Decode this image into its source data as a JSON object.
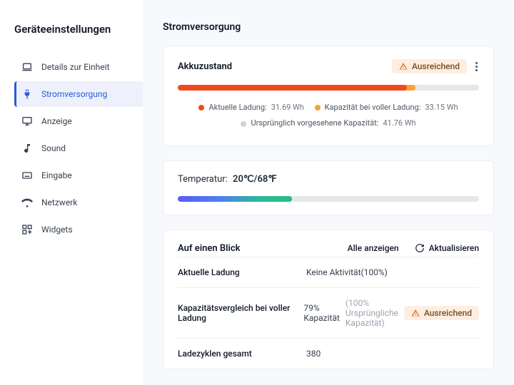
{
  "sidebar": {
    "title": "Geräteeinstellungen",
    "items": [
      {
        "label": "Details zur Einheit",
        "icon": "laptop"
      },
      {
        "label": "Stromversorgung",
        "icon": "plug"
      },
      {
        "label": "Anzeige",
        "icon": "monitor"
      },
      {
        "label": "Sound",
        "icon": "music"
      },
      {
        "label": "Eingabe",
        "icon": "keyboard"
      },
      {
        "label": "Netzwerk",
        "icon": "wifi"
      },
      {
        "label": "Widgets",
        "icon": "widgets"
      }
    ]
  },
  "main": {
    "title": "Stromversorgung",
    "battery": {
      "title": "Akkuzustand",
      "status_label": "Ausreichend",
      "legend": {
        "current_label": "Aktuelle Ladung:",
        "current_value": "31.69 Wh",
        "full_label": "Kapazität bei voller Ladung:",
        "full_value": "33.15 Wh",
        "design_label": "Ursprünglich vorgesehene Kapazität:",
        "design_value": "41.76 Wh"
      }
    },
    "temperature": {
      "label": "Temperatur:",
      "value": "20℃/68℉"
    },
    "glance": {
      "title": "Auf einen Blick",
      "show_all": "Alle anzeigen",
      "refresh": "Aktualisieren",
      "rows": {
        "r0_label": "Aktuelle Ladung",
        "r0_value": "Keine Aktivität(100%)",
        "r1_label": "Kapazitätsvergleich bei voller Ladung",
        "r1_value": "79% Kapazität",
        "r1_note": "(100% Ursprüngliche Kapazität)",
        "r1_status": "Ausreichend",
        "r2_label": "Ladezyklen gesamt",
        "r2_value": "380"
      }
    }
  }
}
